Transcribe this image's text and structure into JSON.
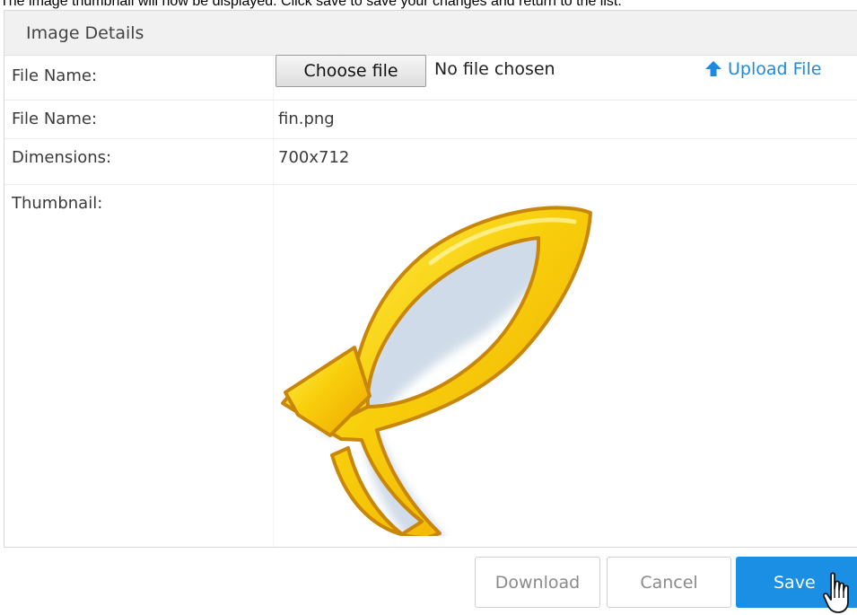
{
  "instruction_text": "The image thumbnail will now be displayed. Click save to save your changes and return to the list.",
  "panel": {
    "title": "Image Details"
  },
  "rows": {
    "upload": {
      "label": "File Name:",
      "choose_button": "Choose file",
      "no_file": "No file chosen",
      "upload_link": "Upload File",
      "upload_icon": "arrow-up-icon"
    },
    "file_name": {
      "label": "File Name:",
      "value": "fin.png"
    },
    "dimensions": {
      "label": "Dimensions:",
      "value": "700x712"
    },
    "thumbnail": {
      "label": "Thumbnail:",
      "image": "ichthys-fish-image"
    }
  },
  "buttons": {
    "download": "Download",
    "cancel": "Cancel",
    "save": "Save"
  },
  "colors": {
    "accent": "#1a8fe3",
    "link": "#1b8ae0",
    "fish_fill": "#f6c40a",
    "fish_stroke": "#c8860a"
  },
  "cursor": "hand-pointer-icon"
}
